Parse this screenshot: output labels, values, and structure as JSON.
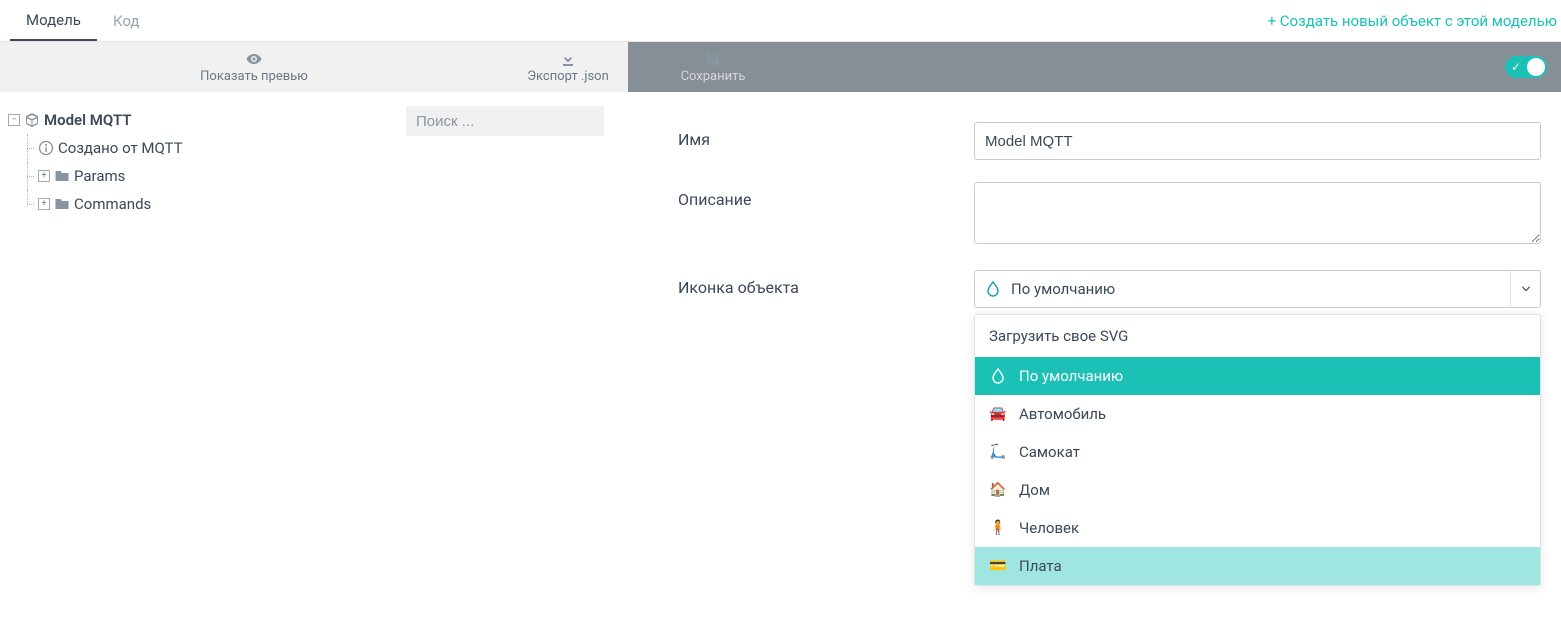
{
  "tabs": {
    "model": "Модель",
    "code": "Код"
  },
  "header": {
    "create_link": "+ Создать новый объект с этой моделью"
  },
  "left_toolbar": {
    "preview": "Показать превью",
    "export": "Экспорт .json"
  },
  "right_toolbar": {
    "save": "Сохранить"
  },
  "tree": {
    "search_placeholder": "Поиск ...",
    "root": "Model MQTT",
    "created_from": "Создано от MQTT",
    "params": "Params",
    "commands": "Commands"
  },
  "form": {
    "name_label": "Имя",
    "name_value": "Model MQTT",
    "desc_label": "Описание",
    "desc_value": "",
    "icon_label": "Иконка объекта",
    "icon_selected": "По умолчанию"
  },
  "dropdown": {
    "upload_svg": "Загрузить свое SVG",
    "items": [
      {
        "label": "По умолчанию",
        "icon": "drop"
      },
      {
        "label": "Автомобиль",
        "icon": "car"
      },
      {
        "label": "Самокат",
        "icon": "scooter"
      },
      {
        "label": "Дом",
        "icon": "house"
      },
      {
        "label": "Человек",
        "icon": "person"
      },
      {
        "label": "Плата",
        "icon": "board"
      }
    ]
  }
}
